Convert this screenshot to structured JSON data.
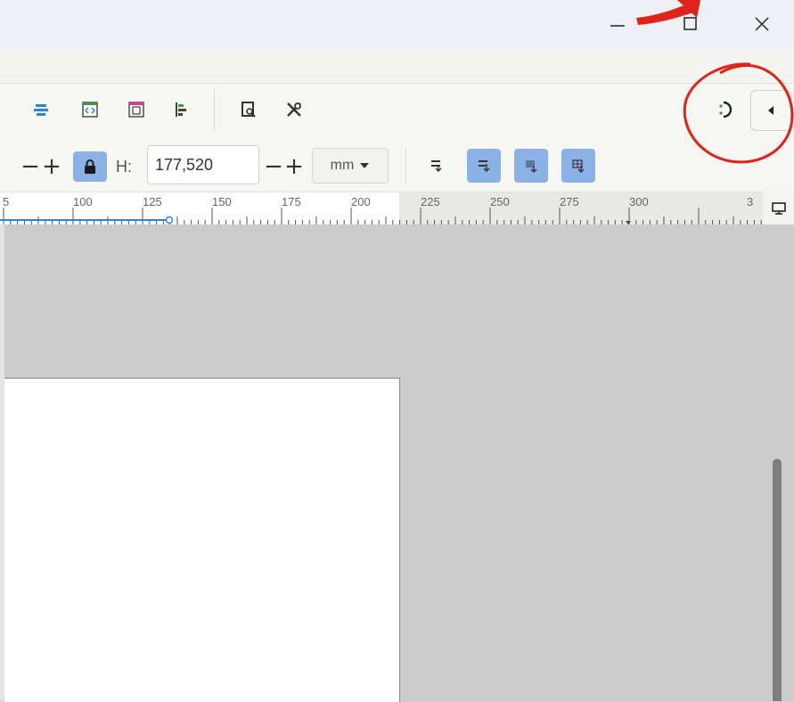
{
  "window": {
    "minimize_icon": "minimize-icon",
    "maximize_icon": "maximize-icon",
    "close_icon": "close-icon"
  },
  "toolbar": {
    "icons": [
      "align-center-icon",
      "xml-editor-icon",
      "page-frame-icon",
      "align-left-icon",
      "document-properties-icon",
      "preferences-icon"
    ],
    "snap_toggle_icon": "snap-toggle-icon",
    "panel_toggle_icon": "chevron-left-icon"
  },
  "tool_controls": {
    "h_label": "H:",
    "h_value": "177,520",
    "minus": "−",
    "plus": "+",
    "unit": "mm",
    "lock_icon": "lock-icon"
  },
  "ruler": {
    "labels": [
      "5",
      "100",
      "125",
      "150",
      "175",
      "200",
      "225",
      "250",
      "275",
      "300",
      "3"
    ]
  },
  "colors": {
    "accent": "#8cb1e6",
    "annotation": "#e0241a"
  }
}
